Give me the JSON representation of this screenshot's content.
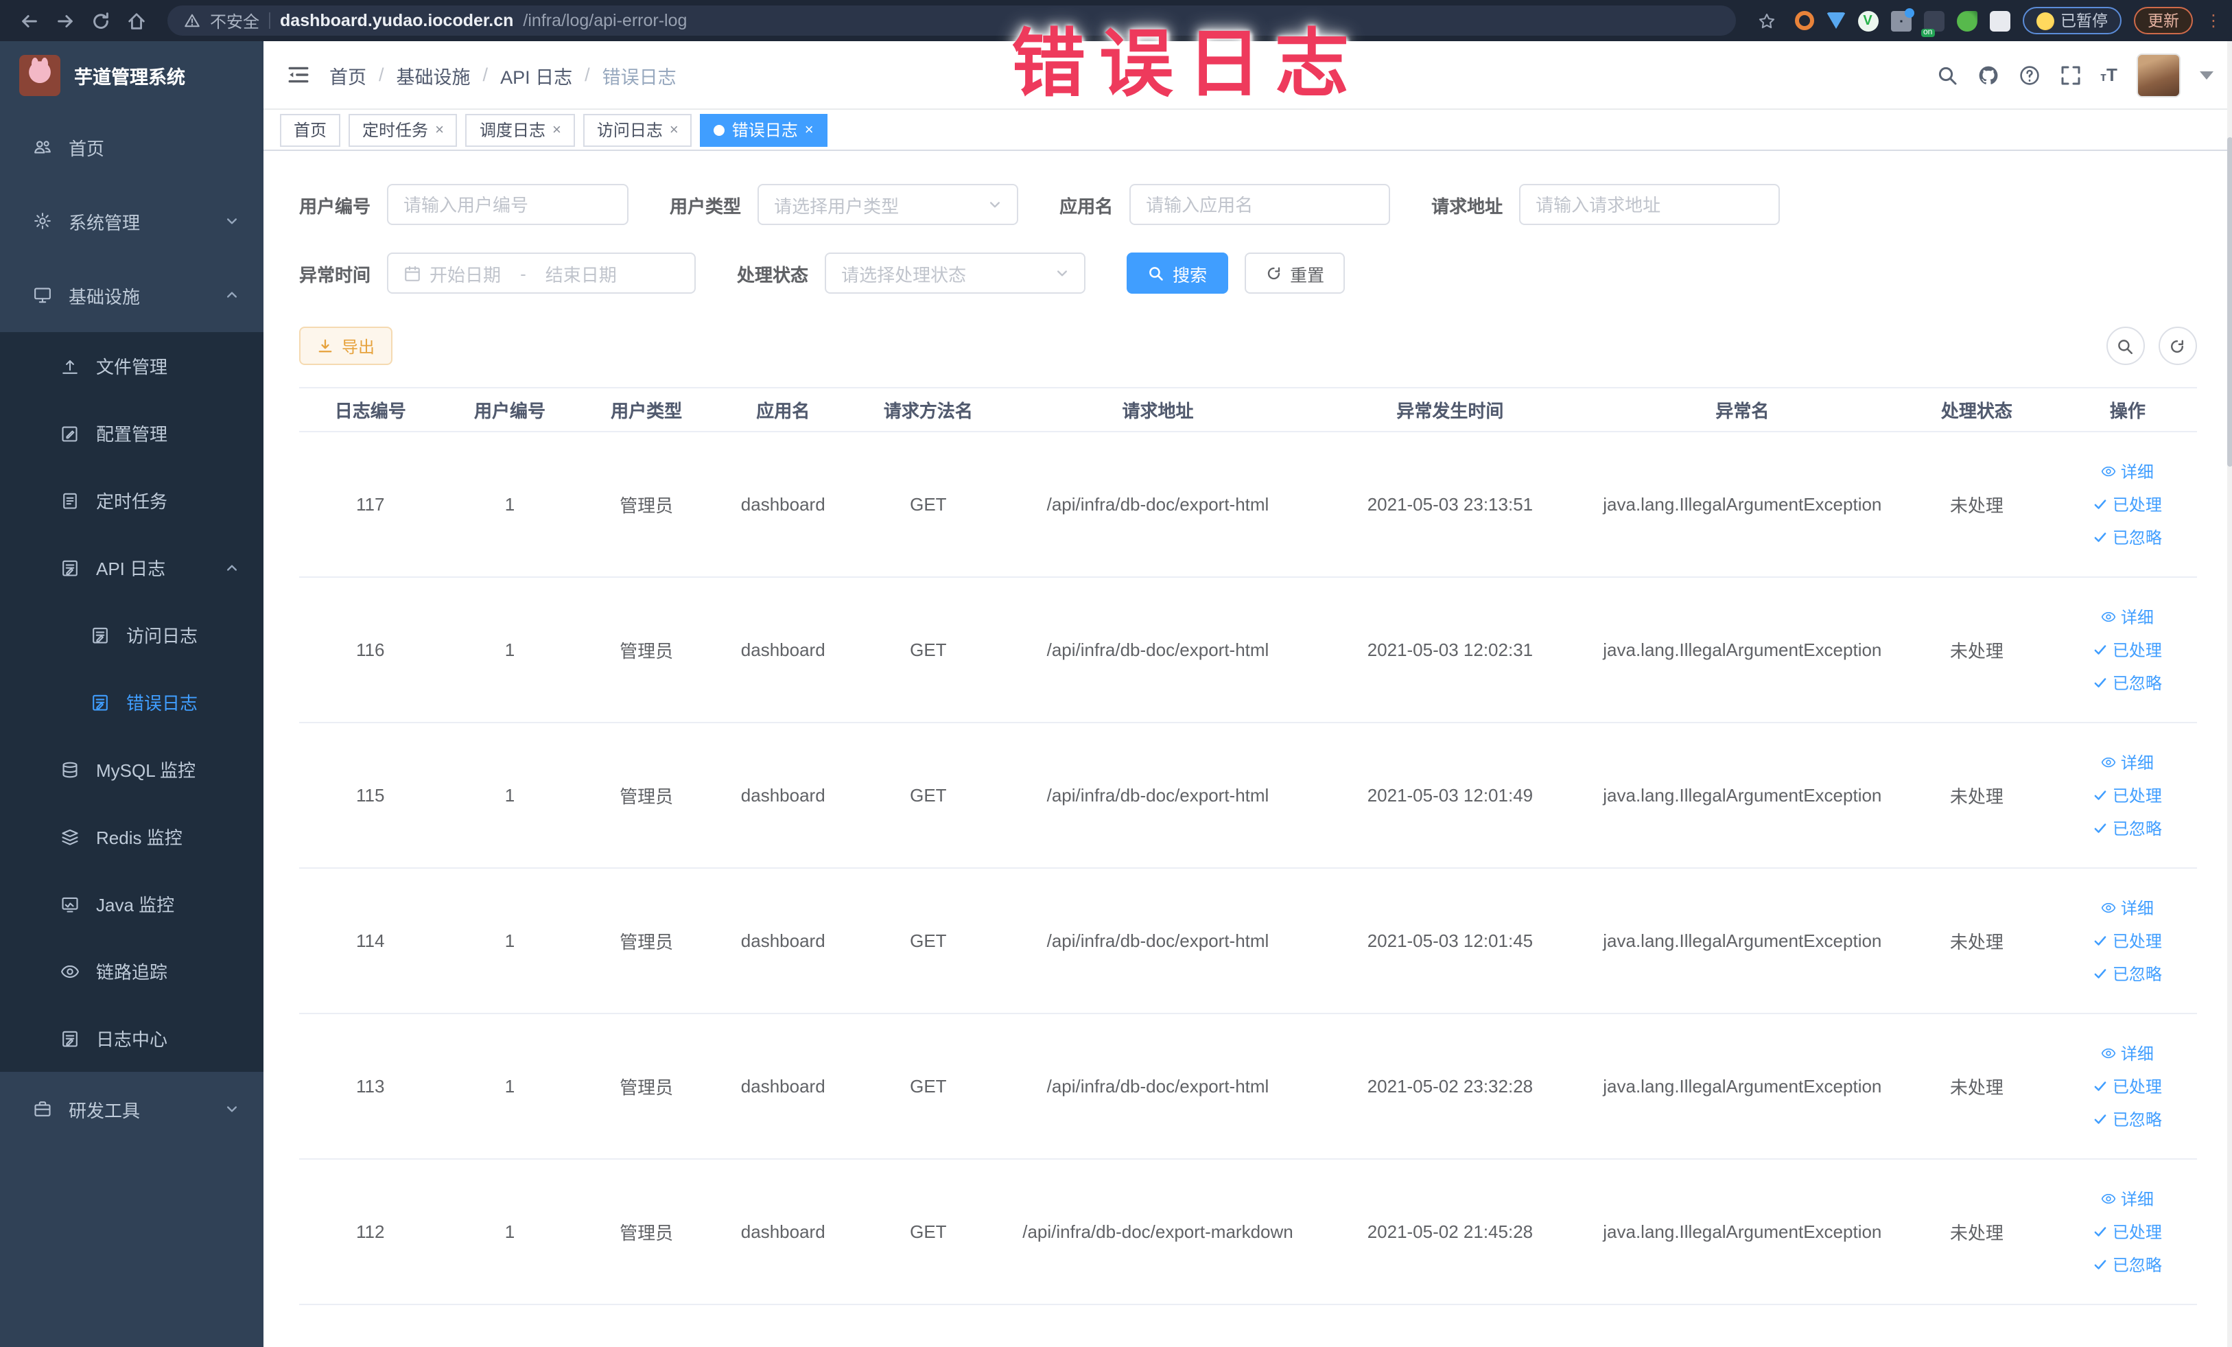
{
  "browser": {
    "security_label": "不安全",
    "url_host": "dashboard.yudao.iocoder.cn",
    "url_path": "/infra/log/api-error-log",
    "paused_label": "已暂停",
    "update_label": "更新",
    "extensions": [
      {
        "key": "ext-ring-orange",
        "shape": "ring-orange"
      },
      {
        "key": "ext-drop-blue",
        "shape": "drop-blue"
      },
      {
        "key": "ext-circle-green",
        "shape": "circle-green",
        "glyph": "V"
      },
      {
        "key": "ext-grid-blue",
        "shape": "grid-blue"
      },
      {
        "key": "ext-badge-on",
        "shape": "badge-on"
      },
      {
        "key": "ext-leaf-green",
        "shape": "leaf-green"
      },
      {
        "key": "ext-puzzle-white",
        "shape": "puzzle-white"
      }
    ]
  },
  "annotation": {
    "text": "错误日志"
  },
  "colors": {
    "accent_blue": "#409EFF",
    "sidebar_bg": "#304156",
    "submenu_bg": "#1f2d3d",
    "warning_orange": "#e6a23c",
    "annotation_red": "#ee3a5c"
  },
  "sidebar": {
    "title": "芋道管理系统",
    "items": [
      {
        "key": "home",
        "label": "首页",
        "icon": "people-icon",
        "level": 1
      },
      {
        "key": "system",
        "label": "系统管理",
        "icon": "gear-icon",
        "level": 1,
        "arrow": "down"
      },
      {
        "key": "infra",
        "label": "基础设施",
        "icon": "monitor-icon",
        "level": 1,
        "arrow": "up"
      },
      {
        "key": "file",
        "label": "文件管理",
        "icon": "upload-icon",
        "level": 2
      },
      {
        "key": "config",
        "label": "配置管理",
        "icon": "edit-icon",
        "level": 2
      },
      {
        "key": "job",
        "label": "定时任务",
        "icon": "clipboard-icon",
        "level": 2
      },
      {
        "key": "api-log",
        "label": "API 日志",
        "icon": "log-icon",
        "level": 2,
        "arrow": "up"
      },
      {
        "key": "access-log",
        "label": "访问日志",
        "icon": "log-icon",
        "level": 3
      },
      {
        "key": "error-log",
        "label": "错误日志",
        "icon": "log-icon",
        "level": 3,
        "active": true
      },
      {
        "key": "mysql",
        "label": "MySQL 监控",
        "icon": "database-icon",
        "level": 2
      },
      {
        "key": "redis",
        "label": "Redis 监控",
        "icon": "layers-icon",
        "level": 2
      },
      {
        "key": "java",
        "label": "Java 监控",
        "icon": "chart-monitor-icon",
        "level": 2
      },
      {
        "key": "trace",
        "label": "链路追踪",
        "icon": "eye-icon",
        "level": 2
      },
      {
        "key": "log-center",
        "label": "日志中心",
        "icon": "log-icon",
        "level": 2
      },
      {
        "key": "dev-tools",
        "label": "研发工具",
        "icon": "toolbox-icon",
        "level": 1,
        "arrow": "down"
      }
    ]
  },
  "navbar": {
    "breadcrumb": [
      {
        "key": "home",
        "label": "首页"
      },
      {
        "key": "infra",
        "label": "基础设施"
      },
      {
        "key": "api-log",
        "label": "API 日志"
      },
      {
        "key": "error-log",
        "label": "错误日志"
      }
    ]
  },
  "tabs": [
    {
      "key": "home",
      "label": "首页",
      "closable": false,
      "active": false
    },
    {
      "key": "job",
      "label": "定时任务",
      "closable": true,
      "active": false
    },
    {
      "key": "schedule-log",
      "label": "调度日志",
      "closable": true,
      "active": false
    },
    {
      "key": "access-log",
      "label": "访问日志",
      "closable": true,
      "active": false
    },
    {
      "key": "error-log",
      "label": "错误日志",
      "closable": true,
      "active": true
    }
  ],
  "filters": {
    "user_id": {
      "label": "用户编号",
      "placeholder": "请输入用户编号",
      "value": ""
    },
    "user_type": {
      "label": "用户类型",
      "placeholder": "请选择用户类型"
    },
    "app_name": {
      "label": "应用名",
      "placeholder": "请输入应用名",
      "value": ""
    },
    "request_url": {
      "label": "请求地址",
      "placeholder": "请输入请求地址",
      "value": ""
    },
    "exception_time": {
      "label": "异常时间",
      "start_placeholder": "开始日期",
      "separator": "-",
      "end_placeholder": "结束日期"
    },
    "process_status": {
      "label": "处理状态",
      "placeholder": "请选择处理状态"
    },
    "search_label": "搜索",
    "reset_label": "重置"
  },
  "toolbar": {
    "export_label": "导出"
  },
  "table": {
    "headers": [
      {
        "key": "log_id",
        "label": "日志编号"
      },
      {
        "key": "user_id",
        "label": "用户编号"
      },
      {
        "key": "user_type",
        "label": "用户类型"
      },
      {
        "key": "app_name",
        "label": "应用名"
      },
      {
        "key": "method",
        "label": "请求方法名"
      },
      {
        "key": "url",
        "label": "请求地址"
      },
      {
        "key": "time",
        "label": "异常发生时间"
      },
      {
        "key": "exception",
        "label": "异常名"
      },
      {
        "key": "status",
        "label": "处理状态"
      },
      {
        "key": "actions",
        "label": "操作"
      }
    ],
    "row_actions": [
      {
        "key": "detail",
        "label": "详细",
        "icon": "eye-icon"
      },
      {
        "key": "processed",
        "label": "已处理",
        "icon": "check-icon"
      },
      {
        "key": "ignored",
        "label": "已忽略",
        "icon": "check-icon"
      }
    ],
    "rows": [
      {
        "log_id": "117",
        "user_id": "1",
        "user_type": "管理员",
        "app_name": "dashboard",
        "method": "GET",
        "url": "/api/infra/db-doc/export-html",
        "time": "2021-05-03 23:13:51",
        "exception": "java.lang.IllegalArgumentException",
        "status": "未处理"
      },
      {
        "log_id": "116",
        "user_id": "1",
        "user_type": "管理员",
        "app_name": "dashboard",
        "method": "GET",
        "url": "/api/infra/db-doc/export-html",
        "time": "2021-05-03 12:02:31",
        "exception": "java.lang.IllegalArgumentException",
        "status": "未处理"
      },
      {
        "log_id": "115",
        "user_id": "1",
        "user_type": "管理员",
        "app_name": "dashboard",
        "method": "GET",
        "url": "/api/infra/db-doc/export-html",
        "time": "2021-05-03 12:01:49",
        "exception": "java.lang.IllegalArgumentException",
        "status": "未处理"
      },
      {
        "log_id": "114",
        "user_id": "1",
        "user_type": "管理员",
        "app_name": "dashboard",
        "method": "GET",
        "url": "/api/infra/db-doc/export-html",
        "time": "2021-05-03 12:01:45",
        "exception": "java.lang.IllegalArgumentException",
        "status": "未处理"
      },
      {
        "log_id": "113",
        "user_id": "1",
        "user_type": "管理员",
        "app_name": "dashboard",
        "method": "GET",
        "url": "/api/infra/db-doc/export-html",
        "time": "2021-05-02 23:32:28",
        "exception": "java.lang.IllegalArgumentException",
        "status": "未处理"
      },
      {
        "log_id": "112",
        "user_id": "1",
        "user_type": "管理员",
        "app_name": "dashboard",
        "method": "GET",
        "url": "/api/infra/db-doc/export-markdown",
        "time": "2021-05-02 21:45:28",
        "exception": "java.lang.IllegalArgumentException",
        "status": "未处理"
      }
    ]
  }
}
